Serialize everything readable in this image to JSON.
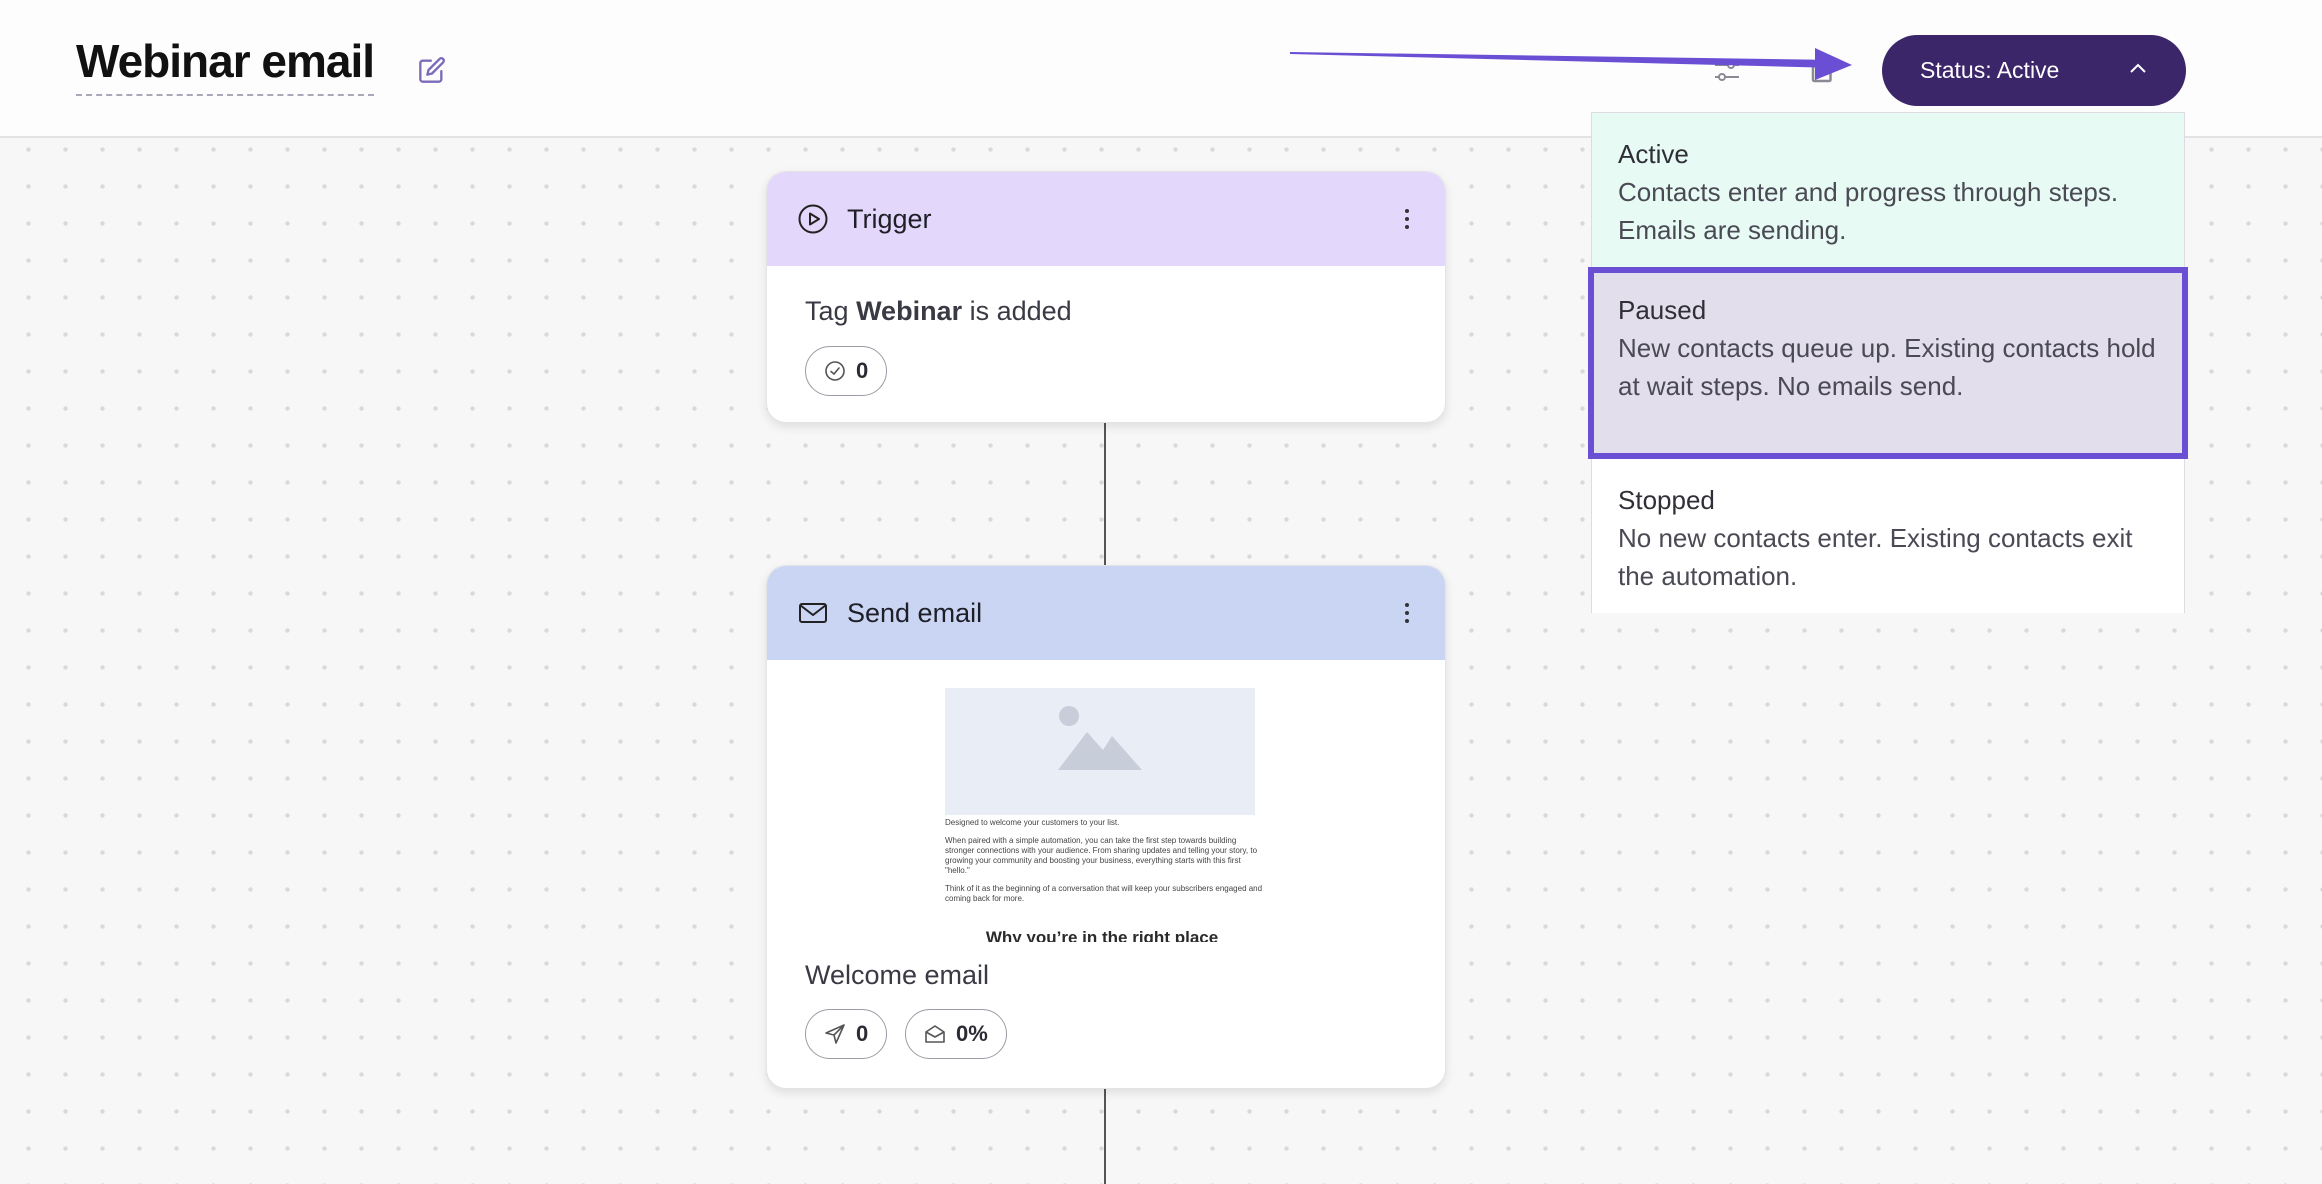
{
  "header": {
    "title": "Webinar email",
    "status_button": "Status: Active"
  },
  "status_menu": {
    "options": [
      {
        "title": "Active",
        "description": "Contacts enter and progress through steps. Emails are sending."
      },
      {
        "title": "Paused",
        "description": "New contacts queue up. Existing contacts hold at wait steps. No emails send."
      },
      {
        "title": "Stopped",
        "description": "No new contacts enter. Existing contacts exit the automation."
      }
    ],
    "highlighted": "Paused"
  },
  "trigger_card": {
    "title": "Trigger",
    "text_prefix": "Tag",
    "tag_name": "Webinar",
    "text_suffix": "is added",
    "completed_count": "0"
  },
  "email_card": {
    "title": "Send email",
    "email_name": "Welcome email",
    "sent_count": "0",
    "open_rate": "0%",
    "preview": {
      "line1": "Designed to welcome your customers to your list.",
      "line2": "When paired with a simple automation, you can take the first step towards building stronger connections with your audience. From sharing updates and telling your story, to growing your community and boosting your business, everything starts with this first \"hello.\"",
      "line3": "Think of it as the beginning of a conversation that will keep your subscribers engaged and coming back for more.",
      "heading": "Why you’re in the right place"
    }
  },
  "colors": {
    "status_button_bg": "#3b2669",
    "trigger_header": "#e3d8fb",
    "email_header": "#cad5f3",
    "active_option_bg": "#e8faf4",
    "highlight_border": "#6a4fd4",
    "annotation_arrow": "#6a4fd4"
  },
  "icons": {
    "edit": "edit-icon",
    "filter": "sliders-icon",
    "share": "share-icon",
    "chevron": "chevron-up-icon",
    "trigger": "play-circle-icon",
    "email": "envelope-icon",
    "menu": "kebab-menu-icon",
    "completed": "check-circle-icon",
    "sent": "paper-plane-icon",
    "opened": "envelope-open-icon"
  }
}
